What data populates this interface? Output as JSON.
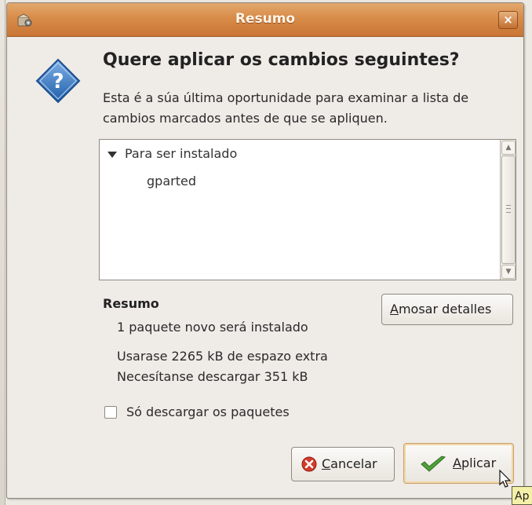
{
  "window": {
    "title": "Resumo",
    "close_symbol": "×"
  },
  "dialog": {
    "heading": "Quere aplicar os cambios seguintes?",
    "description": "Esta é a súa última oportunidade para examinar a lista de cambios marcados antes de que se apliquen."
  },
  "changes_list": {
    "group_label": "Para ser instalado",
    "items": [
      "gparted"
    ]
  },
  "summary": {
    "label": "Resumo",
    "lines": [
      "1 paquete novo será instalado",
      "Usarase 2265 kB de espazo extra",
      "Necesítanse descargar 351 kB"
    ]
  },
  "details_button": {
    "mnemonic": "A",
    "rest": "mosar detalles"
  },
  "download_only": {
    "label": "Só descargar os paquetes",
    "checked": false
  },
  "buttons": {
    "cancel": {
      "mnemonic": "C",
      "rest": "ancelar"
    },
    "apply": {
      "mnemonic": "A",
      "rest": "plicar"
    }
  },
  "tooltip": {
    "text": "Ap"
  },
  "icons": {
    "window_icon": "package-manager-icon",
    "dialog_icon": "question-icon",
    "cancel_icon": "cancel-icon",
    "apply_icon": "checkmark-icon"
  },
  "colors": {
    "titlebar": "#d88c48",
    "question_icon": "#2e6fb8",
    "cancel_icon": "#d23b2b",
    "apply_icon": "#4fa23a"
  }
}
